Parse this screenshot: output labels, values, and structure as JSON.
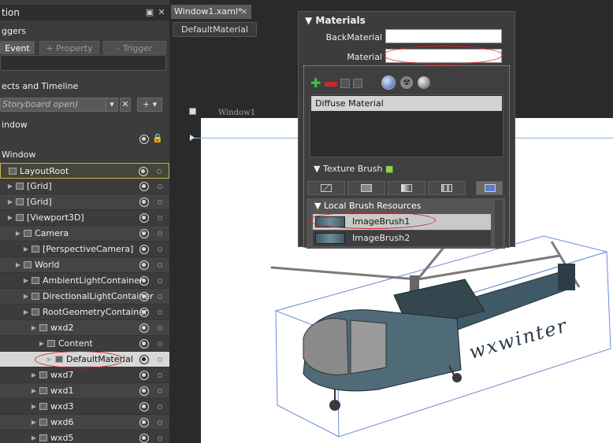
{
  "left_panel": {
    "title": "tion",
    "triggers_header": "ggers",
    "trigger_tabs": [
      "Event",
      "+ Property",
      "- Trigger"
    ],
    "objects_header": "ects and Timeline",
    "storyboard_text": "Storyboard open)",
    "add_button": "+ ▾",
    "root_label": "indow",
    "tree": [
      {
        "label": "Window",
        "indent": 0
      },
      {
        "label": "LayoutRoot",
        "indent": 0
      },
      {
        "label": "[Grid]",
        "indent": 1
      },
      {
        "label": "[Grid]",
        "indent": 1
      },
      {
        "label": "[Viewport3D]",
        "indent": 1
      },
      {
        "label": "Camera",
        "indent": 2
      },
      {
        "label": "[PerspectiveCamera]",
        "indent": 3
      },
      {
        "label": "World",
        "indent": 2
      },
      {
        "label": "AmbientLightContainer",
        "indent": 3
      },
      {
        "label": "DirectionalLightContainer",
        "indent": 3
      },
      {
        "label": "RootGeometryContainer",
        "indent": 3
      },
      {
        "label": "wxd2",
        "indent": 4
      },
      {
        "label": "Content",
        "indent": 5
      },
      {
        "label": "DefaultMaterial",
        "indent": 6
      },
      {
        "label": "wxd7",
        "indent": 4
      },
      {
        "label": "wxd1",
        "indent": 4
      },
      {
        "label": "wxd3",
        "indent": 4
      },
      {
        "label": "wxd6",
        "indent": 4
      },
      {
        "label": "wxd5",
        "indent": 4
      }
    ]
  },
  "document": {
    "tab": "Window1.xaml*",
    "tab_close": "×",
    "breadcrumb": "DefaultMaterial",
    "artboard_label": "Window1"
  },
  "materials": {
    "title": "Materials",
    "back_material_label": "BackMaterial",
    "material_label": "Material",
    "list_item": "Diffuse Material",
    "texture_brush_label": "Texture Brush",
    "local_brush_resources_label": "Local Brush Resources",
    "brushes": [
      "ImageBrush1",
      "ImageBrush2"
    ]
  },
  "scene": {
    "watermark": "wxwinter"
  },
  "colors": {
    "panel_bg": "#3c3c3c",
    "highlight_ellipse": "#d0202a",
    "selection_outline": "#c8b84a",
    "bounding_box": "#5a7fd0"
  }
}
